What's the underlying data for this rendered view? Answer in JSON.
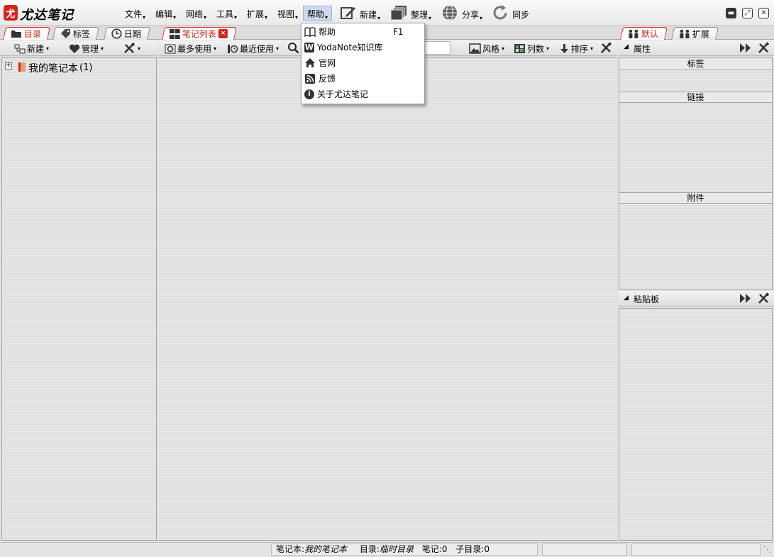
{
  "app": {
    "logo_glyph": "尤",
    "name": "尤达笔记"
  },
  "menus": [
    {
      "label": "文件"
    },
    {
      "label": "编辑"
    },
    {
      "label": "网络"
    },
    {
      "label": "工具"
    },
    {
      "label": "扩展"
    },
    {
      "label": "视图"
    },
    {
      "label": "帮助"
    }
  ],
  "toolbar_main": {
    "new_label": "新建",
    "organize_label": "整理",
    "share_label": "分享",
    "sync_label": "同步"
  },
  "help_menu": {
    "items": [
      {
        "label": "帮助",
        "shortcut": "F1",
        "icon": "book-icon"
      },
      {
        "label": "YodaNote知识库",
        "icon": "wiki-icon"
      },
      {
        "label": "官网",
        "icon": "home-icon"
      },
      {
        "label": "反馈",
        "icon": "rss-icon"
      },
      {
        "label": "关于尤达笔记",
        "icon": "info-icon"
      }
    ]
  },
  "left_tabs": [
    {
      "label": "目录",
      "icon": "folder-icon",
      "selected": true
    },
    {
      "label": "标签",
      "icon": "tag-icon"
    },
    {
      "label": "日期",
      "icon": "clock-icon"
    }
  ],
  "center_tab": {
    "label": "笔记列表",
    "icon": "grid-icon"
  },
  "right_tabs": [
    {
      "label": "默认",
      "icon": "people-icon",
      "selected": true
    },
    {
      "label": "扩展",
      "icon": "people-icon"
    }
  ],
  "left_toolbar": {
    "new_label": "新建",
    "manage_label": "管理"
  },
  "center_toolbar": {
    "most_used_label": "最多使用",
    "recent_label": "最近使用",
    "style_label": "风格",
    "columns_label": "列数",
    "sort_label": "排序",
    "search_value": ""
  },
  "tree": {
    "root_label": "我的笔记本",
    "root_count": "(1)"
  },
  "properties": {
    "title": "属性",
    "sections": [
      "标签",
      "链接",
      "附件"
    ]
  },
  "clipboard": {
    "title": "粘贴板"
  },
  "statusbar": {
    "notebook_label": "笔记本:",
    "notebook_value": "我的笔记本",
    "dir_label": "目录:",
    "dir_value": "临时目录",
    "notes_label": "笔记:",
    "notes_value": "0",
    "subdir_label": "子目录:",
    "subdir_value": "0"
  },
  "colors": {
    "accent": "#d6241b",
    "menu_highlight": "#cfd9ee"
  }
}
